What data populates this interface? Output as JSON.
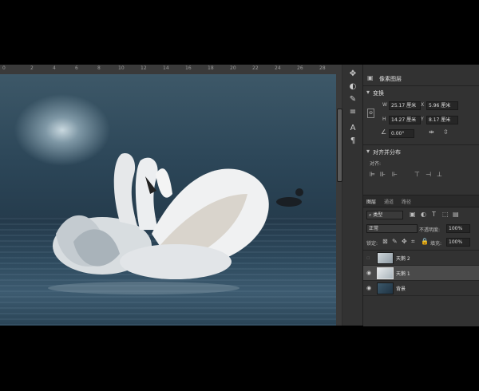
{
  "ruler": {
    "labels": [
      "0",
      "2",
      "4",
      "6",
      "8",
      "10",
      "12",
      "14",
      "16",
      "18",
      "20",
      "22",
      "24",
      "26",
      "28"
    ]
  },
  "toolbar": {
    "icons": [
      "move-icon",
      "adjust-icon",
      "brush-icon",
      "sliders-icon",
      "type-icon",
      "paragraph-icon"
    ]
  },
  "properties": {
    "tab_label": "像素图层",
    "transform": {
      "title": "变换",
      "w_label": "W",
      "w_value": "25.17 厘米",
      "x_label": "X",
      "x_value": "5.96 厘米",
      "h_label": "H",
      "h_value": "14.27 厘米",
      "y_label": "Y",
      "y_value": "8.17 厘米",
      "angle_value": "0.00°"
    },
    "align": {
      "title": "对齐并分布",
      "sub": "对齐:"
    }
  },
  "layers": {
    "tabs": [
      "图层",
      "通道",
      "路径"
    ],
    "kind_label": "类型",
    "blend_mode": "正常",
    "opacity_label": "不透明度:",
    "opacity_value": "100%",
    "lock_label": "锁定:",
    "fill_label": "填充:",
    "fill_value": "100%",
    "items": [
      {
        "name": "天鹅 2",
        "visible": false,
        "selected": false
      },
      {
        "name": "天鹅 1",
        "visible": true,
        "selected": true
      },
      {
        "name": "背景",
        "visible": true,
        "selected": false
      }
    ]
  }
}
